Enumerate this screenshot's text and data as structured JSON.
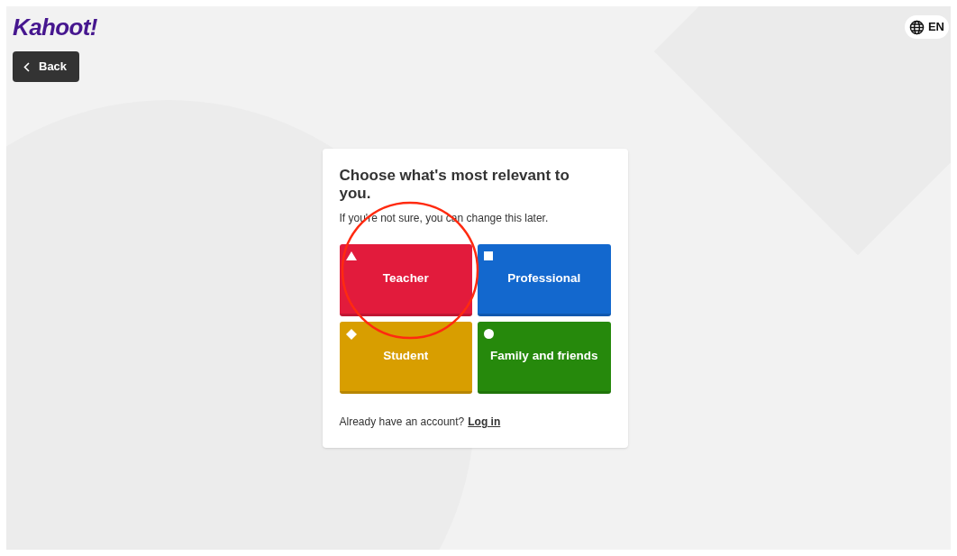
{
  "logo": "Kahoot!",
  "back_button": "Back",
  "language": "EN",
  "card": {
    "title": "Choose what's most relevant to you.",
    "subtitle": "If you're not sure, you can change this later.",
    "options": [
      {
        "label": "Teacher",
        "kind": "triangle",
        "color": "#e21b3c"
      },
      {
        "label": "Professional",
        "kind": "square",
        "color": "#1368ce"
      },
      {
        "label": "Student",
        "kind": "diamond",
        "color": "#d89e00"
      },
      {
        "label": "Family and friends",
        "kind": "circle",
        "color": "#26890c"
      }
    ],
    "account_prompt": "Already have an account?",
    "login_link": "Log in"
  }
}
